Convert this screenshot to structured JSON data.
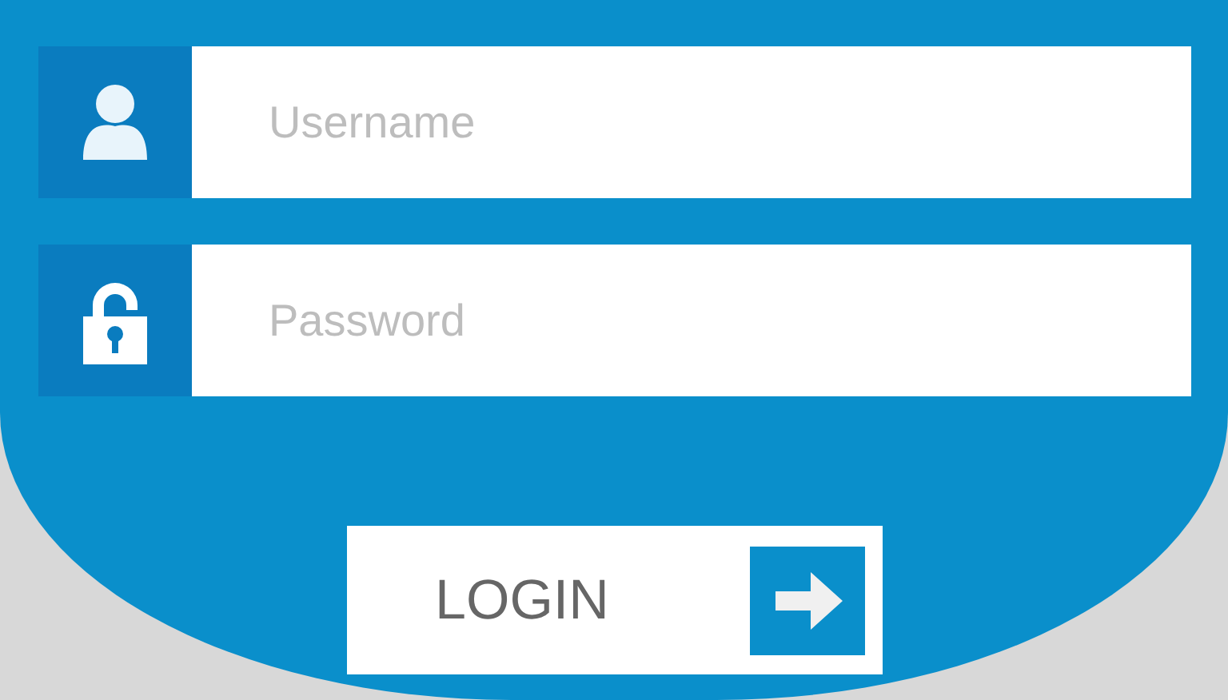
{
  "fields": [
    {
      "kind": "user",
      "placeholder": "Username"
    },
    {
      "kind": "lock",
      "placeholder": "Password"
    }
  ],
  "login_button": {
    "label": "LOGIN"
  }
}
